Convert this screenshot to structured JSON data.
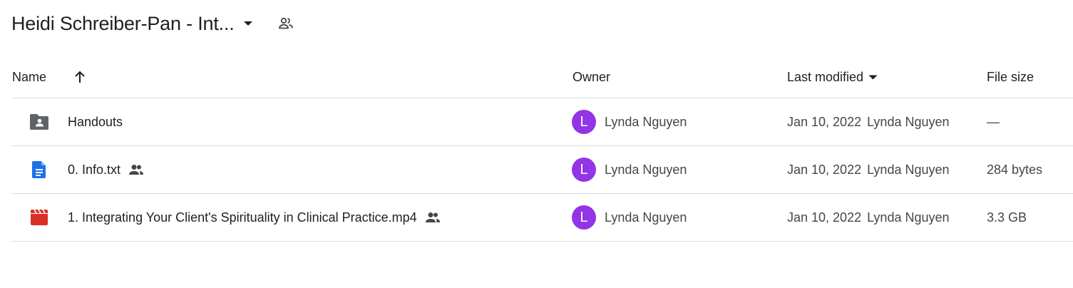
{
  "header": {
    "folder_title": "Heidi Schreiber-Pan - Int...",
    "caret_icon": "arrow-drop-down-icon",
    "shared_icon": "people-outline-icon"
  },
  "columns": {
    "name": "Name",
    "owner": "Owner",
    "last_modified": "Last modified",
    "file_size": "File size",
    "sort_icon": "arrow-up-icon"
  },
  "colors": {
    "avatar_bg": "#9334e6",
    "doc_blue": "#1a73e8",
    "video_red": "#d93025",
    "folder_gray": "#5f6368",
    "divider": "#dadce0"
  },
  "rows": [
    {
      "icon": "shared-folder-icon",
      "name": "Handouts",
      "shared": false,
      "owner_initial": "L",
      "owner": "Lynda Nguyen",
      "modified_date": "Jan 10, 2022",
      "modified_by": "Lynda Nguyen",
      "size": "—"
    },
    {
      "icon": "text-document-icon",
      "name": "0. Info.txt",
      "shared": true,
      "owner_initial": "L",
      "owner": "Lynda Nguyen",
      "modified_date": "Jan 10, 2022",
      "modified_by": "Lynda Nguyen",
      "size": "284 bytes"
    },
    {
      "icon": "video-file-icon",
      "name": "1. Integrating Your Client's Spirituality in Clinical Practice.mp4",
      "shared": true,
      "owner_initial": "L",
      "owner": "Lynda Nguyen",
      "modified_date": "Jan 10, 2022",
      "modified_by": "Lynda Nguyen",
      "size": "3.3 GB"
    }
  ]
}
